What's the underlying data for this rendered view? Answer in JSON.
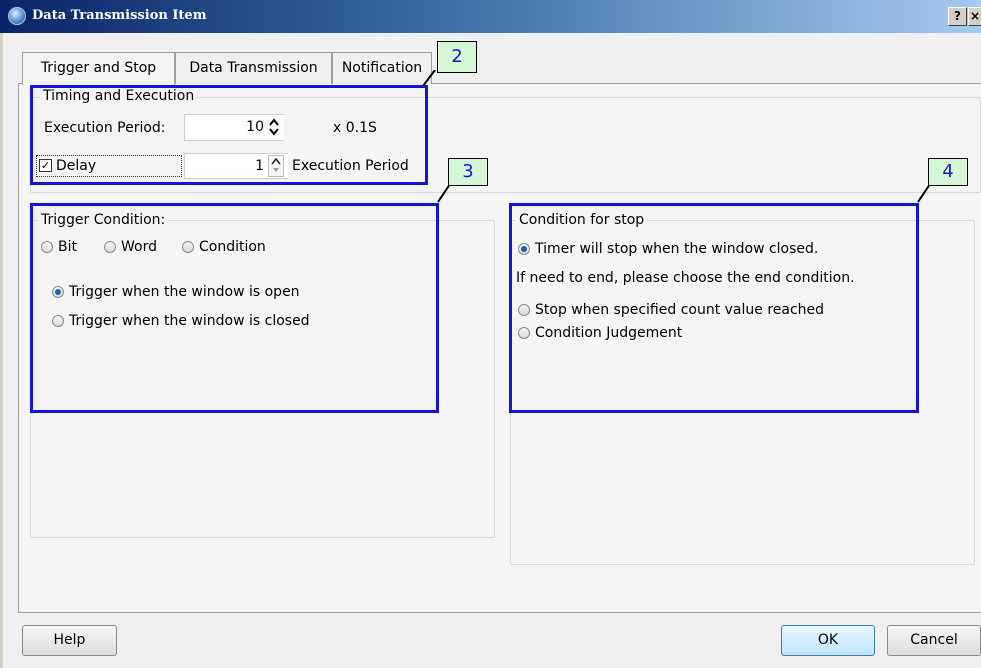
{
  "window": {
    "title": "Data Transmission Item",
    "help_btn": "?",
    "close_btn": "×"
  },
  "tabs": [
    "Trigger and Stop",
    "Data Transmission",
    "Notification"
  ],
  "timing": {
    "group_label": "Timing and Execution",
    "exec_period_label": "Execution Period:",
    "exec_period_value": "10",
    "exec_unit": "x 0.1S",
    "delay_label": "Delay",
    "delay_checked": true,
    "delay_value": "1",
    "delay_unit": "Execution Period"
  },
  "trigger": {
    "group_label": "Trigger Condition:",
    "type_options": [
      "Bit",
      "Word",
      "Condition"
    ],
    "options": [
      "Trigger when the window is open",
      "Trigger when the window is closed"
    ],
    "selected": 0
  },
  "stop": {
    "group_label": "Condition for stop",
    "timer_option": "Timer will stop when the window closed.",
    "note": "If need to end, please choose the end condition.",
    "options": [
      "Stop when specified count value reached",
      "Condition Judgement"
    ]
  },
  "callouts": [
    "2",
    "3",
    "4"
  ],
  "buttons": {
    "help": "Help",
    "ok": "OK",
    "cancel": "Cancel"
  },
  "colors": {
    "annotation_blue": "#1414d8",
    "callout_green": "#d6f7d6",
    "title_bar": "#0a246a"
  }
}
